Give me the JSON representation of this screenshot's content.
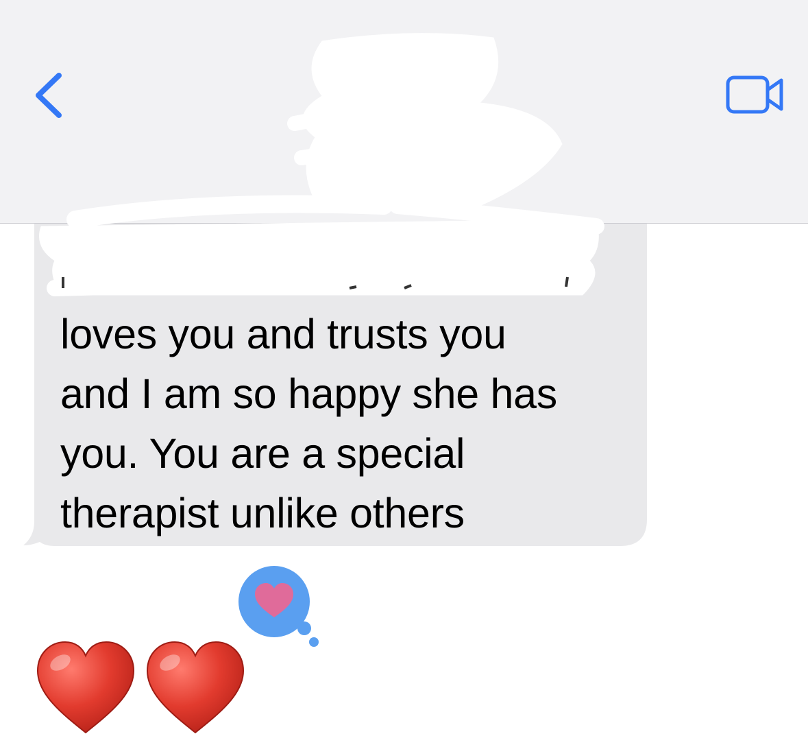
{
  "header": {
    "back_icon": "chevron-left-icon",
    "video_icon": "video-camera-icon",
    "accent_color": "#3478f6",
    "background_color": "#f2f2f4"
  },
  "message": {
    "bubble_color": "#e9e9eb",
    "lines": [
      "loves you and trusts you",
      "and I am so happy she has",
      "you. You are a special",
      "therapist unlike others"
    ],
    "tapback_icon": "heart-icon",
    "tapback_color": "#5a9ff0"
  },
  "reply": {
    "emoji_icon": "red-heart-emoji",
    "count": 2,
    "color": "#e23b2e"
  }
}
